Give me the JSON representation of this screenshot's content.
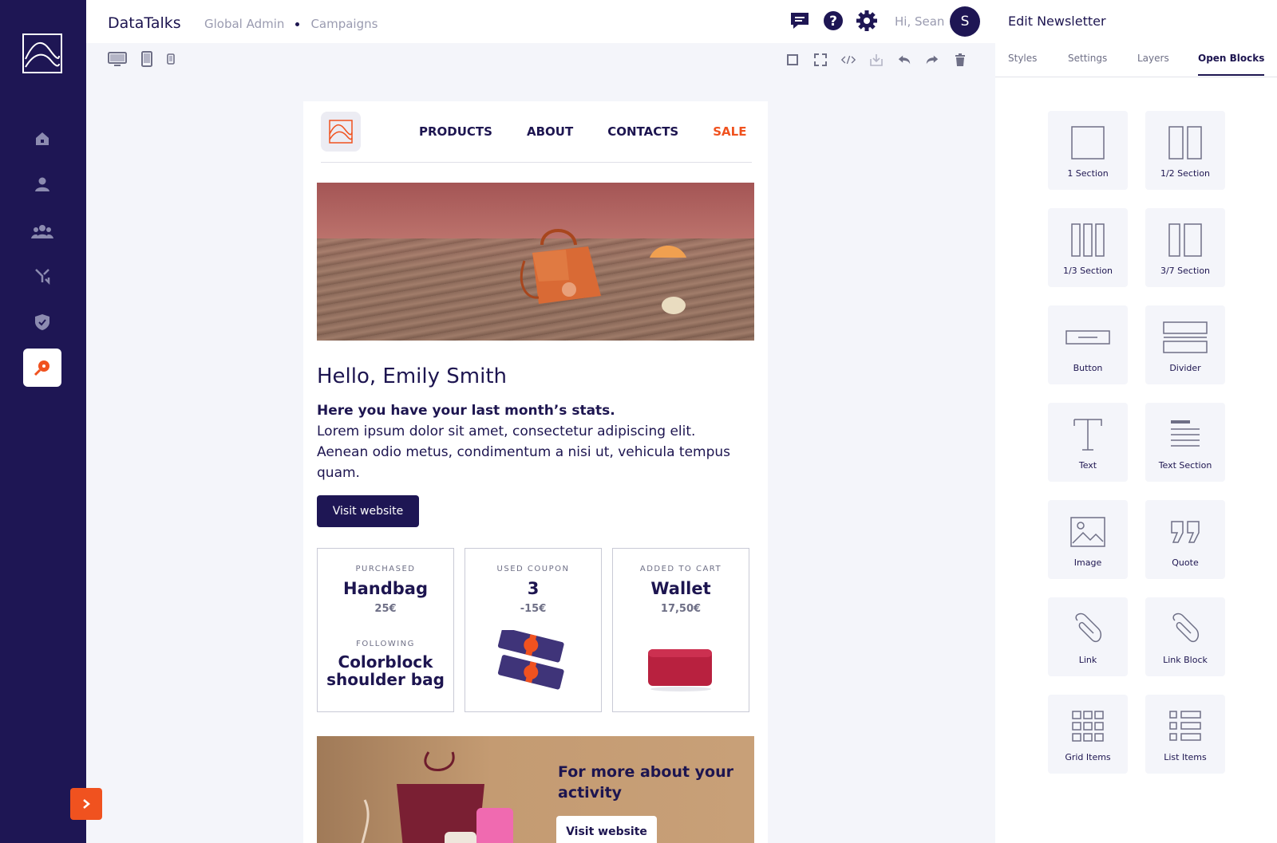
{
  "app": {
    "name": "DataTalks",
    "breadcrumb": [
      "Global Admin",
      "Campaigns"
    ],
    "greeting": "Hi, Sean",
    "avatar_initial": "S"
  },
  "colors": {
    "navy": "#1e1654",
    "accent": "#f0521f",
    "canvas": "#f4f5fa"
  },
  "rail": {
    "items": [
      "home-icon",
      "user-icon",
      "users-icon",
      "merge-icon",
      "shield-icon",
      "campaign-icon"
    ],
    "active": "campaign-icon"
  },
  "topbar_icons": [
    "chat-icon",
    "help-icon",
    "gear-icon"
  ],
  "toolbar": {
    "devices": [
      "desktop-icon",
      "tablet-icon",
      "mobile-icon"
    ],
    "tools": [
      "select-icon",
      "fullscreen-icon",
      "code-icon",
      "import-icon",
      "undo-icon",
      "redo-icon",
      "trash-icon"
    ]
  },
  "email": {
    "nav": [
      "PRODUCTS",
      "ABOUT",
      "CONTACTS",
      "SALE"
    ],
    "greeting": "Hello, Emily Smith",
    "lead": "Here you have your last month’s stats.",
    "body": "Lorem ipsum dolor sit amet, consectetur adipiscing elit. Aenean odio metus, condimentum a nisi ut, vehicula tempus quam.",
    "cta": "Visit website",
    "stats": [
      {
        "label": "PURCHASED",
        "value": "Handbag",
        "sub": "25€",
        "label2": "FOLLOWING",
        "value2": "Colorblock shoulder bag"
      },
      {
        "label": "USED COUPON",
        "value": "3",
        "sub": "-15€"
      },
      {
        "label": "ADDED TO CART",
        "value": "Wallet",
        "sub": "17,50€"
      }
    ],
    "promo_title": "For more about your activity",
    "promo_cta": "Visit website"
  },
  "panel": {
    "title": "Edit Newsletter",
    "tabs": [
      "Styles",
      "Settings",
      "Layers",
      "Open Blocks"
    ],
    "active_tab": "Open Blocks",
    "blocks": [
      "1 Section",
      "1/2 Section",
      "1/3 Section",
      "3/7 Section",
      "Button",
      "Divider",
      "Text",
      "Text Section",
      "Image",
      "Quote",
      "Link",
      "Link Block",
      "Grid Items",
      "List Items"
    ]
  }
}
